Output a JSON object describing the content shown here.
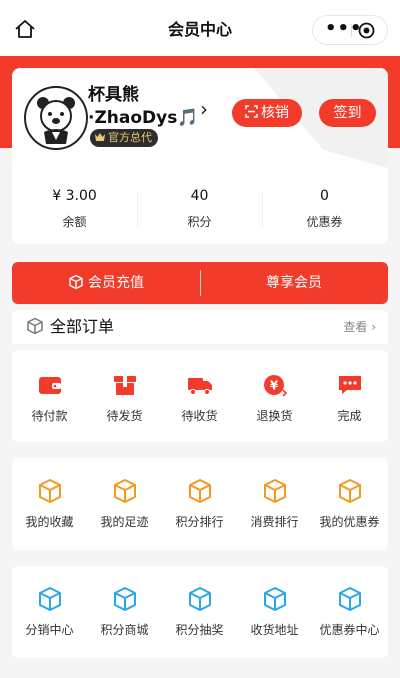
{
  "navbar": {
    "title": "会员中心"
  },
  "profile": {
    "name_line1": "杯具熊",
    "name_line2": "·ZhaoDys🎵",
    "badge": "官方总代",
    "verify_label": "核销",
    "checkin_label": "签到"
  },
  "stats": [
    {
      "value": "¥ 3.00",
      "label": "余额"
    },
    {
      "value": "40",
      "label": "积分"
    },
    {
      "value": "0",
      "label": "优惠券"
    }
  ],
  "member_bar": {
    "recharge_label": "会员充值",
    "vip_label": "尊享会员"
  },
  "orders": {
    "title": "全部订单",
    "more": "查看 ›",
    "items": [
      {
        "label": "待付款",
        "icon": "wallet-icon"
      },
      {
        "label": "待发货",
        "icon": "package-icon"
      },
      {
        "label": "待收货",
        "icon": "truck-icon"
      },
      {
        "label": "退换货",
        "icon": "refund-icon"
      },
      {
        "label": "完成",
        "icon": "chat-bubble-icon"
      }
    ]
  },
  "features_row1": [
    {
      "label": "我的收藏",
      "icon": "cube-icon"
    },
    {
      "label": "我的足迹",
      "icon": "cube-icon"
    },
    {
      "label": "积分排行",
      "icon": "cube-icon"
    },
    {
      "label": "消费排行",
      "icon": "cube-icon"
    },
    {
      "label": "我的优惠券",
      "icon": "cube-icon"
    }
  ],
  "features_row2": [
    {
      "label": "分销中心",
      "icon": "cube-icon"
    },
    {
      "label": "积分商城",
      "icon": "cube-icon"
    },
    {
      "label": "积分抽奖",
      "icon": "cube-icon"
    },
    {
      "label": "收货地址",
      "icon": "cube-icon"
    },
    {
      "label": "优惠券中心",
      "icon": "cube-icon"
    }
  ],
  "colors": {
    "brand_red": "#f23b2b",
    "orange": "#f39a1e",
    "blue": "#29a8e8"
  }
}
